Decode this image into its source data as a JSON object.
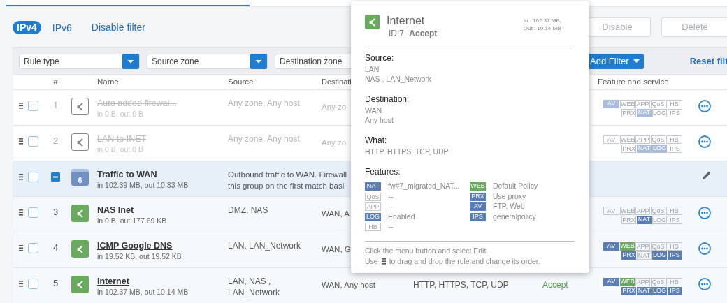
{
  "ip_tabs": [
    {
      "label": "IPv4",
      "selected": true
    },
    {
      "label": "IPv6",
      "selected": false
    }
  ],
  "disable_filter": "Disable filter",
  "toolbar_buttons": [
    {
      "label": "Disable",
      "disabled": true
    },
    {
      "label": "Delete",
      "disabled": true
    }
  ],
  "filters": [
    {
      "placeholder": "Rule type",
      "kind": "select"
    },
    {
      "placeholder": "Source zone",
      "kind": "select"
    },
    {
      "placeholder": "Destination zone",
      "kind": "plain"
    }
  ],
  "add_filter": "Add Filter",
  "reset_filter": "Reset filt",
  "table": {
    "columns": [
      "#",
      "Name",
      "Source",
      "Destinati",
      "Feature and service"
    ],
    "rows": [
      {
        "kind": "rule",
        "checked": false,
        "enabled": false,
        "number": "1",
        "name": "Auto added firewal...",
        "traffic": "in 0 B, out 0 B",
        "source": "Any zone, Any host",
        "destination": "Any zo",
        "features": [
          {
            "label": "AV",
            "on": true,
            "color": "#a9bcdb"
          },
          {
            "label": "WEB",
            "on": false
          },
          {
            "label": "APP",
            "on": false
          },
          {
            "label": "QoS",
            "on": false
          },
          {
            "label": "HB",
            "on": false
          },
          {
            "label": "PRX",
            "on": false
          },
          {
            "label": "NAT",
            "on": true,
            "color": "#a9bcdb"
          },
          {
            "label": "LOG",
            "on": false
          },
          {
            "label": "IPS",
            "on": false
          }
        ]
      },
      {
        "kind": "rule",
        "checked": false,
        "enabled": false,
        "number": "2",
        "name": "LAN to INET",
        "traffic": "in 0 B, out 0 B",
        "source": "Any zone, Any host",
        "destination": "Any zo",
        "features": [
          {
            "label": "AV",
            "on": false
          },
          {
            "label": "WEB",
            "on": false
          },
          {
            "label": "APP",
            "on": false
          },
          {
            "label": "QoS",
            "on": false
          },
          {
            "label": "HB",
            "on": false
          },
          {
            "label": "PRX",
            "on": false
          },
          {
            "label": "NAT",
            "on": true,
            "color": "#a9bcdb"
          },
          {
            "label": "LOG",
            "on": true,
            "color": "#a9bcdb"
          },
          {
            "label": "IPS",
            "on": false
          }
        ]
      },
      {
        "kind": "group",
        "checked": false,
        "expanded": true,
        "count": "6",
        "name": "Traffic to WAN",
        "traffic": "in 102.39 MB, out 10.33 MB",
        "description_lines": [
          "Outbound traffic to WAN. Firewall",
          "this group on the first match basi"
        ]
      },
      {
        "kind": "rule",
        "checked": false,
        "enabled": true,
        "number": "3",
        "name": "NAS Inet",
        "traffic": "in 0 B, out 177.69 KB",
        "source": "DMZ, NAS",
        "destination": "WAN, A",
        "features": [
          {
            "label": "AV",
            "on": false
          },
          {
            "label": "WEB",
            "on": false
          },
          {
            "label": "APP",
            "on": false
          },
          {
            "label": "QoS",
            "on": false
          },
          {
            "label": "HB",
            "on": false
          },
          {
            "label": "PRX",
            "on": false
          },
          {
            "label": "NAT",
            "on": true,
            "color": "#5a7db6"
          },
          {
            "label": "LOG",
            "on": false
          },
          {
            "label": "IPS",
            "on": false
          }
        ]
      },
      {
        "kind": "rule",
        "checked": false,
        "enabled": true,
        "number": "4",
        "name": "ICMP Google DNS",
        "traffic": "in 19.52 KB, out 19.52 KB",
        "source": "LAN, LAN_Network",
        "destination": "WAN, G",
        "features": [
          {
            "label": "AV",
            "on": true,
            "color": "#5a7db6"
          },
          {
            "label": "WEB",
            "on": true,
            "color": "#6aaa5e"
          },
          {
            "label": "APP",
            "on": false
          },
          {
            "label": "QoS",
            "on": false
          },
          {
            "label": "HB",
            "on": false
          },
          {
            "label": "PRX",
            "on": true,
            "color": "#5a7db6"
          },
          {
            "label": "NAT",
            "on": false
          },
          {
            "label": "LOG",
            "on": true,
            "color": "#5a7db6"
          },
          {
            "label": "IPS",
            "on": true,
            "color": "#5a7db6"
          }
        ]
      },
      {
        "kind": "rule",
        "checked": false,
        "enabled": true,
        "number": "5",
        "name": "Internet",
        "traffic": "in 102.37 MB, out 10.14 MB",
        "source": "LAN, NAS , LAN_Network",
        "destination": "WAN, Any host",
        "service": "HTTP, HTTPS, TCP, UDP",
        "action": "Accept",
        "features": [
          {
            "label": "AV",
            "on": true,
            "color": "#5a7db6"
          },
          {
            "label": "WEB",
            "on": true,
            "color": "#6aaa5e"
          },
          {
            "label": "APP",
            "on": false
          },
          {
            "label": "QoS",
            "on": false
          },
          {
            "label": "HB",
            "on": false
          },
          {
            "label": "PRX",
            "on": true,
            "color": "#5a7db6"
          },
          {
            "label": "NAT",
            "on": true,
            "color": "#5a7db6"
          },
          {
            "label": "LOG",
            "on": true,
            "color": "#5a7db6"
          },
          {
            "label": "IPS",
            "on": true,
            "color": "#5a7db6"
          }
        ]
      }
    ]
  },
  "popover": {
    "title": "Internet",
    "subtitle": "ID:7 -**Accept**",
    "stats": [
      "In : 102.37 MB,",
      "Out : 10.14 MB"
    ],
    "sections": [
      {
        "label": "Source:",
        "values": [
          "LAN",
          "NAS , LAN_Network"
        ]
      },
      {
        "label": "Destination:",
        "values": [
          "WAN",
          "Any host"
        ]
      },
      {
        "label": "What:",
        "values": [
          "HTTP, HTTPS, TCP, UDP"
        ]
      }
    ],
    "features_label": "Features:",
    "feature_columns": [
      [
        {
          "label": "NAT",
          "value": "fw#7_migrated_NAT...",
          "on": true,
          "color": "#5a7db6"
        },
        {
          "label": "QoS",
          "value": "--",
          "on": false
        },
        {
          "label": "APP",
          "value": "--",
          "on": false
        },
        {
          "label": "LOG",
          "value": "Enabled",
          "on": true,
          "color": "#5a7db6"
        },
        {
          "label": "HB",
          "value": "--",
          "on": false
        }
      ],
      [
        {
          "label": "WEB",
          "value": "Default Policy",
          "on": true,
          "color": "#6aaa5e"
        },
        {
          "label": "PRX",
          "value": "Use proxy",
          "on": true,
          "color": "#5a7db6"
        },
        {
          "label": "AV",
          "value": "FTP, Web",
          "on": true,
          "color": "#5a7db6"
        },
        {
          "label": "IPS",
          "value": "generalpolicy",
          "on": true,
          "color": "#5a7db6"
        }
      ]
    ],
    "hint": "Click the menu button and select Edit.",
    "hint2_before": "Use",
    "hint2_after": "to drag and drop the rule and change its order."
  }
}
